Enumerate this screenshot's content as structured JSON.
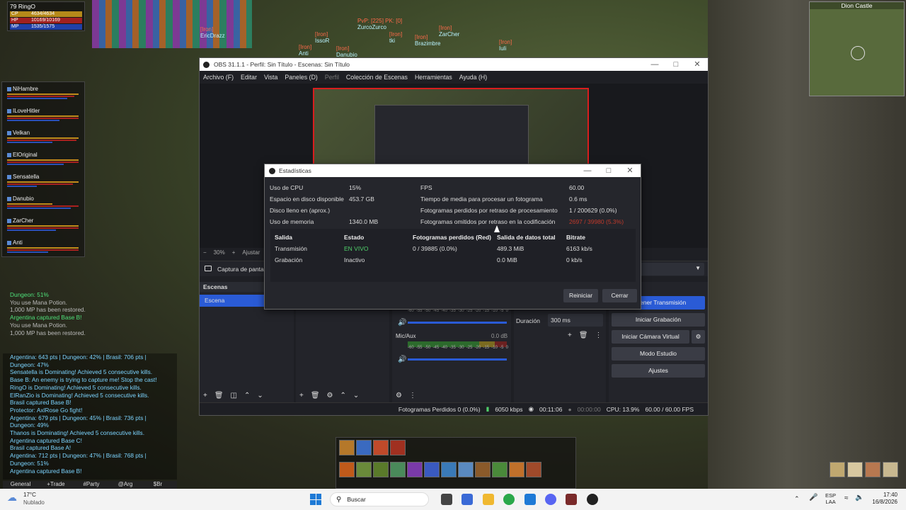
{
  "game": {
    "player": {
      "level": "79",
      "name": "RingO",
      "cp": "CP",
      "cp_val": "4634/4634",
      "hp": "HP",
      "hp_val": "10169/10169",
      "mp": "MP",
      "mp_val": "1535/1575"
    },
    "minimap_title": "Dion Castle",
    "party": [
      {
        "name": "NiHambre"
      },
      {
        "name": "ILoveHitler"
      },
      {
        "name": "Velkan"
      },
      {
        "name": "ElOriginal"
      },
      {
        "name": "Sensatella"
      },
      {
        "name": "Danubio"
      },
      {
        "name": "ZarCher"
      },
      {
        "name": "Anti"
      }
    ],
    "nameplates": [
      {
        "clan": "[Iron]",
        "name": "IssoR"
      },
      {
        "clan": "[Iron]",
        "name": "Anti"
      },
      {
        "clan": "[Iron]",
        "name": "Danubio"
      },
      {
        "clan": "[Iron]",
        "name": "EricDrazz"
      },
      {
        "pvp": "PvP: [225] PK: [0]",
        "name": "ZurcoZurco"
      },
      {
        "clan": "[Iron]",
        "name": "tki"
      },
      {
        "clan": "[Iron]",
        "name": "ZarCher"
      },
      {
        "clan": "[Iron]",
        "name": "Brazimbre"
      },
      {
        "clan": "[Iron]",
        "name": "Iuli"
      }
    ],
    "chat_top": [
      {
        "text": "Dungeon: 51%",
        "c": "g"
      },
      {
        "text": "You use Mana Potion.",
        "c": "w"
      },
      {
        "text": "1,000 MP has been restored.",
        "c": "w"
      },
      {
        "text": "Argentina captured Base B!",
        "c": "g"
      },
      {
        "text": "You use Mana Potion.",
        "c": "w"
      },
      {
        "text": "1,000 MP has been restored.",
        "c": "w"
      }
    ],
    "chat_bottom": [
      {
        "text": "Argentina: 643 pts | Dungeon: 42% | Brasil: 706 pts |"
      },
      {
        "text": "Dungeon: 47%"
      },
      {
        "text": "Sensatella is Dominating! Achieved 5 consecutive kills."
      },
      {
        "text": "Base B: An enemy is trying to capture me! Stop the cast!"
      },
      {
        "text": "RingO is Dominating! Achieved 5 consecutive kills."
      },
      {
        "text": "ElRanZio is Dominating! Achieved 5 consecutive kills."
      },
      {
        "text": "Brasil captured Base B!"
      },
      {
        "text": "Protector: AxlRose Go fight!"
      },
      {
        "text": "Argentina: 679 pts | Dungeon: 45% | Brasil: 736 pts |"
      },
      {
        "text": "Dungeon: 49%"
      },
      {
        "text": "Thanos is Dominating! Achieved 5 consecutive kills."
      },
      {
        "text": "Argentina captured Base C!"
      },
      {
        "text": "Brasil captured Base A!"
      },
      {
        "text": "Argentina: 712 pts | Dungeon: 47% | Brasil: 768 pts |"
      },
      {
        "text": "Dungeon: 51%"
      },
      {
        "text": "Argentina captured Base B!"
      }
    ],
    "chat_tabs": [
      "General",
      "+Trade",
      "#Party",
      "@Arg",
      "$Br"
    ]
  },
  "obs": {
    "title": "OBS 31.1.1 - Perfil: Sin Título - Escenas: Sin Título",
    "menu": [
      "Archivo (F)",
      "Editar",
      "Vista",
      "Paneles (D)",
      "Perfil",
      "Colección de Escenas",
      "Herramientas",
      "Ayuda (H)"
    ],
    "zoom": "30%",
    "fit": "Ajustar",
    "source": "Captura de pantalla",
    "scenes_title": "Escenas",
    "scene_item": "Escena",
    "mixer": [
      {
        "name": "Mic/Aux",
        "db": "0.0 dB"
      }
    ],
    "scale": [
      "-60",
      "-55",
      "-50",
      "-45",
      "-40",
      "-35",
      "-30",
      "-25",
      "-20",
      "-15",
      "-10",
      "-5",
      "0"
    ],
    "duration_label": "Duración",
    "duration_value": "300 ms",
    "controls": [
      "Detener Transmisión",
      "Iniciar Grabación",
      "Iniciar Cámara Virtual",
      "Modo Estudio",
      "Ajustes"
    ],
    "status": {
      "dropped": "Fotogramas Perdidos 0 (0.0%)",
      "bitrate": "6050 kbps",
      "live_time": "00:11:06",
      "rec_time": "00:00:00",
      "cpu": "CPU: 13.9%",
      "fps": "60.00 / 60.00 FPS"
    }
  },
  "stats": {
    "title": "Estadísticas",
    "left": [
      {
        "k": "Uso de CPU",
        "v": "15%"
      },
      {
        "k": "Espacio en disco disponible",
        "v": "453.7 GB"
      },
      {
        "k": "Disco lleno en (aprox.)",
        "v": ""
      },
      {
        "k": "Uso de memoria",
        "v": "1340.0 MB"
      }
    ],
    "right": [
      {
        "k": "FPS",
        "v": "60.00"
      },
      {
        "k": "Tiempo de media para procesar un fotograma",
        "v": "0.6 ms"
      },
      {
        "k": "Fotogramas perdidos por retraso de procesamiento",
        "v": "1 / 200629 (0.0%)"
      },
      {
        "k": "Fotogramas omitidos por retraso en la codificación",
        "v": "2697 / 39980 (5.3%)"
      }
    ],
    "table_headers": [
      "Salida",
      "Estado",
      "Fotogramas perdidos (Red)",
      "Salida de datos total",
      "Bitrate"
    ],
    "rows": [
      [
        "Transmisión",
        "EN VIVO",
        "0 / 39885 (0.0%)",
        "489.3 MiB",
        "6163 kb/s"
      ],
      [
        "Grabación",
        "Inactivo",
        "",
        "0.0 MiB",
        "0 kb/s"
      ]
    ],
    "reset": "Reiniciar",
    "close": "Cerrar"
  },
  "taskbar": {
    "weather_temp": "17°C",
    "weather_desc": "Nublado",
    "search": "Buscar",
    "lang1": "ESP",
    "lang2": "LAA",
    "time": "17:40",
    "date": "16/8/2026"
  }
}
